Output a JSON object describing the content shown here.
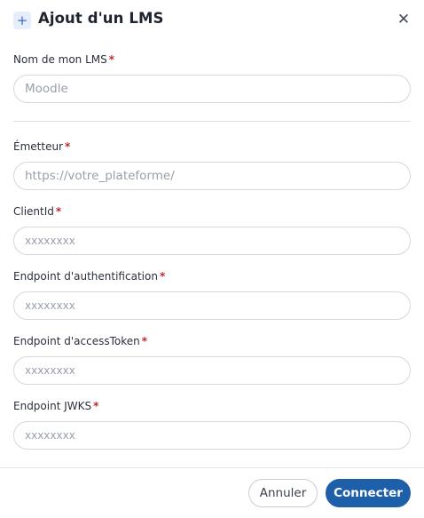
{
  "dialog": {
    "title": "Ajout d'un LMS",
    "title_icon": "plus-icon",
    "close_icon": "close-icon"
  },
  "fields": {
    "lms_name": {
      "label": "Nom de mon LMS",
      "required_mark": "*",
      "placeholder": "Moodle",
      "value": ""
    },
    "issuer": {
      "label": "Émetteur",
      "required_mark": "*",
      "placeholder": "https://votre_plateforme/",
      "value": ""
    },
    "client_id": {
      "label": "ClientId",
      "required_mark": "*",
      "placeholder": "xxxxxxxx",
      "value": ""
    },
    "auth_endpoint": {
      "label": "Endpoint d'authentification",
      "required_mark": "*",
      "placeholder": "xxxxxxxx",
      "value": ""
    },
    "token_endpoint": {
      "label": "Endpoint d'accessToken",
      "required_mark": "*",
      "placeholder": "xxxxxxxx",
      "value": ""
    },
    "jwks_endpoint": {
      "label": "Endpoint JWKS",
      "required_mark": "*",
      "placeholder": "xxxxxxxx",
      "value": ""
    }
  },
  "footer": {
    "cancel_label": "Annuler",
    "connect_label": "Connecter"
  },
  "colors": {
    "primary": "#1d5fa8",
    "required": "#c0282d",
    "border": "#d4d7de"
  }
}
